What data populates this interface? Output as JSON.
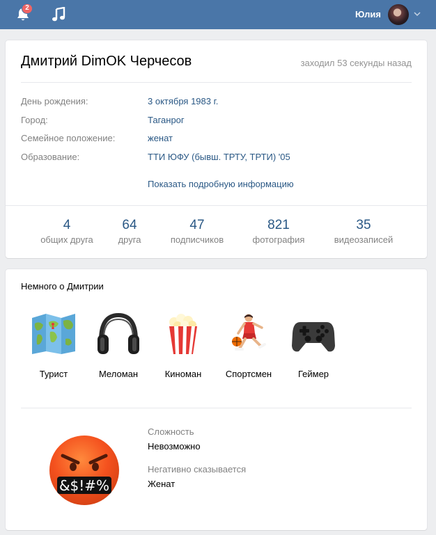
{
  "topbar": {
    "notifications_count": "2",
    "user_name": "Юлия"
  },
  "profile": {
    "name": "Дмитрий DimOK Черчесов",
    "last_seen": "заходил 53 секунды назад",
    "info": [
      {
        "label": "День рождения:",
        "value": "3 октября 1983 г.",
        "is_link": true
      },
      {
        "label": "Город:",
        "value": "Таганрог",
        "is_link": true
      },
      {
        "label": "Семейное положение:",
        "value": "женат",
        "is_link": true
      },
      {
        "label": "Образование:",
        "value": "ТТИ ЮФУ (бывш. ТРТУ, ТРТИ) '05",
        "is_link": true
      }
    ],
    "show_more": "Показать подробную информацию",
    "counters": [
      {
        "num": "4",
        "label": "общих друга"
      },
      {
        "num": "64",
        "label": "друга"
      },
      {
        "num": "47",
        "label": "подписчиков"
      },
      {
        "num": "821",
        "label": "фотография"
      },
      {
        "num": "35",
        "label": "видеозаписей"
      }
    ]
  },
  "about": {
    "title": "Немного о Дмитрии",
    "traits": [
      {
        "label": "Турист",
        "icon": "map-icon"
      },
      {
        "label": "Меломан",
        "icon": "headphones-icon"
      },
      {
        "label": "Киноман",
        "icon": "popcorn-icon"
      },
      {
        "label": "Спортсмен",
        "icon": "basketball-player-icon"
      },
      {
        "label": "Геймер",
        "icon": "gamepad-icon"
      }
    ],
    "difficulty_label": "Сложность",
    "difficulty_value": "Невозможно",
    "negative_label": "Негативно сказывается",
    "negative_value": "Женат",
    "emoji_icon": "angry-cursing-face-icon",
    "emoji_text": "&$!#%"
  },
  "colors": {
    "header": "#4a76a8",
    "link": "#2a5885",
    "muted": "#828282",
    "badge": "#f06464"
  }
}
